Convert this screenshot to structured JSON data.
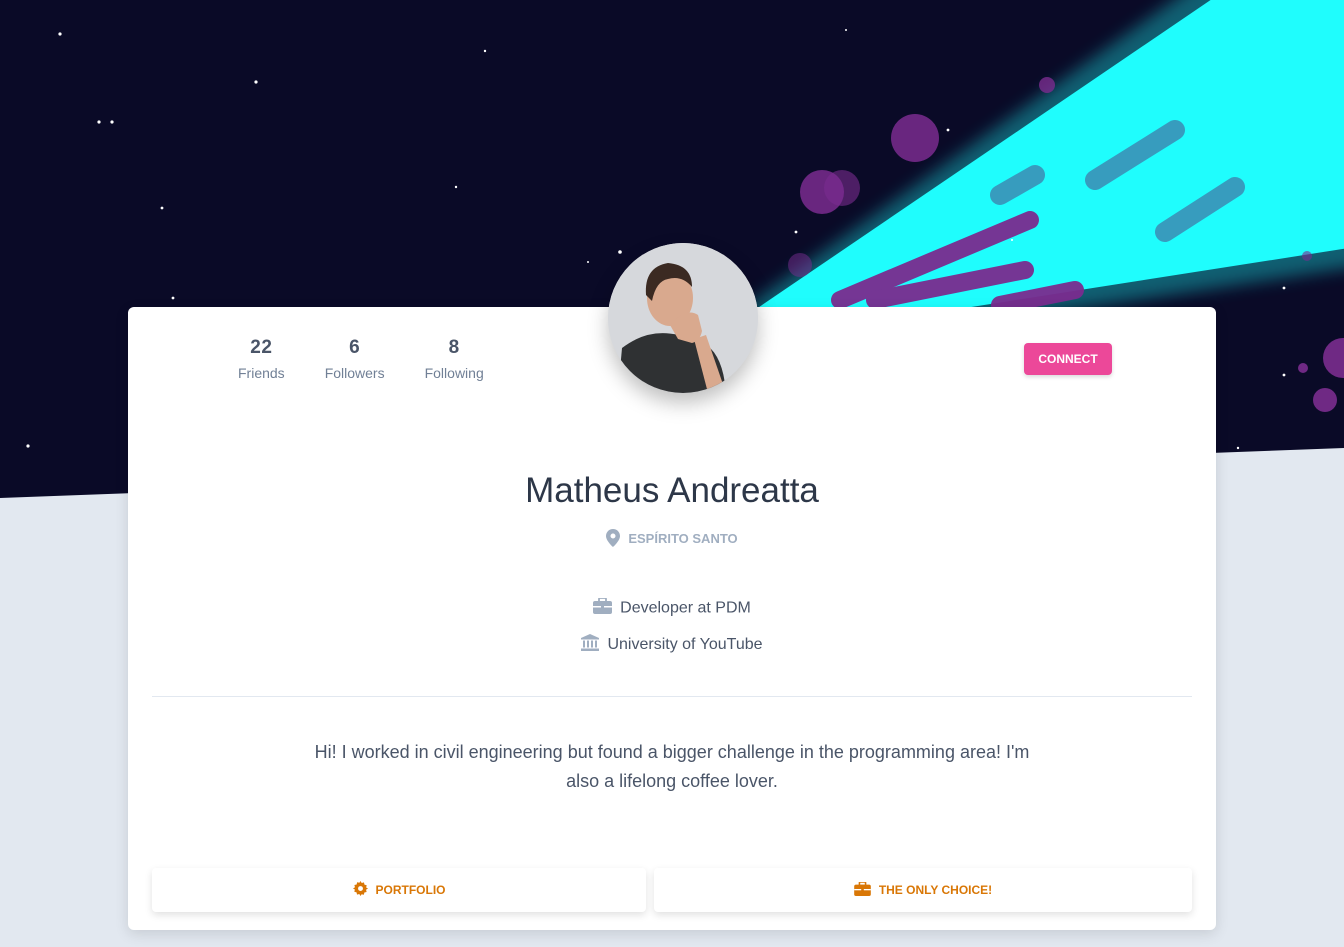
{
  "profile": {
    "name": "Matheus Andreatta",
    "location": "ESPÍRITO SANTO",
    "job": "Developer at PDM",
    "education": "University of YouTube",
    "bio": "Hi! I worked in civil engineering but found a bigger challenge in the programming area! I'm also a lifelong coffee lover."
  },
  "stats": [
    {
      "value": "22",
      "label": "Friends"
    },
    {
      "value": "6",
      "label": "Followers"
    },
    {
      "value": "8",
      "label": "Following"
    }
  ],
  "actions": {
    "connect_label": "CONNECT",
    "portfolio_label": "PORTFOLIO",
    "choice_label": "THE ONLY CHOICE!"
  },
  "icons": {
    "location": "map-marker-icon",
    "job": "briefcase-icon",
    "education": "university-icon",
    "portfolio": "gear-icon",
    "choice": "briefcase-icon"
  },
  "colors": {
    "hero_bg": "#0a0a27",
    "accent_pink": "#ec4899",
    "accent_cyan": "#1ffdfd",
    "link_orange": "#d97706",
    "page_bg": "#e2e8f0"
  }
}
